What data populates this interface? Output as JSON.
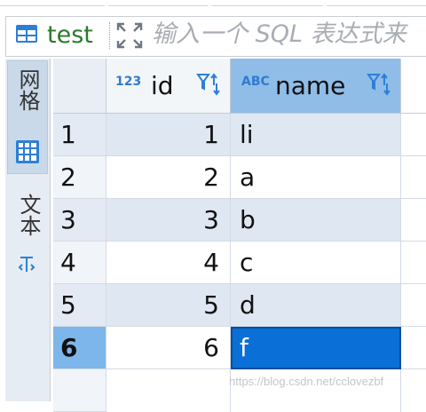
{
  "toolbar": {
    "table_name": "test",
    "filter_placeholder": "输入一个 SQL 表达式来"
  },
  "sidebar": {
    "grid_label": "网格",
    "text_label": "文本"
  },
  "columns": [
    {
      "type_badge": "123",
      "label": "id"
    },
    {
      "type_badge": "ABC",
      "label": "name"
    }
  ],
  "rows": [
    {
      "num": "1",
      "id": "1",
      "name": "li"
    },
    {
      "num": "2",
      "id": "2",
      "name": "a"
    },
    {
      "num": "3",
      "id": "3",
      "name": "b"
    },
    {
      "num": "4",
      "id": "4",
      "name": "c"
    },
    {
      "num": "5",
      "id": "5",
      "name": "d"
    },
    {
      "num": "6",
      "id": "6",
      "name": "f"
    }
  ],
  "selected_row": "6",
  "watermark": "https://blog.csdn.net/cclovezbf",
  "colors": {
    "accent": "#0a6fd6",
    "header_selected": "#8fbde8",
    "table_name": "#2b7a2b"
  }
}
